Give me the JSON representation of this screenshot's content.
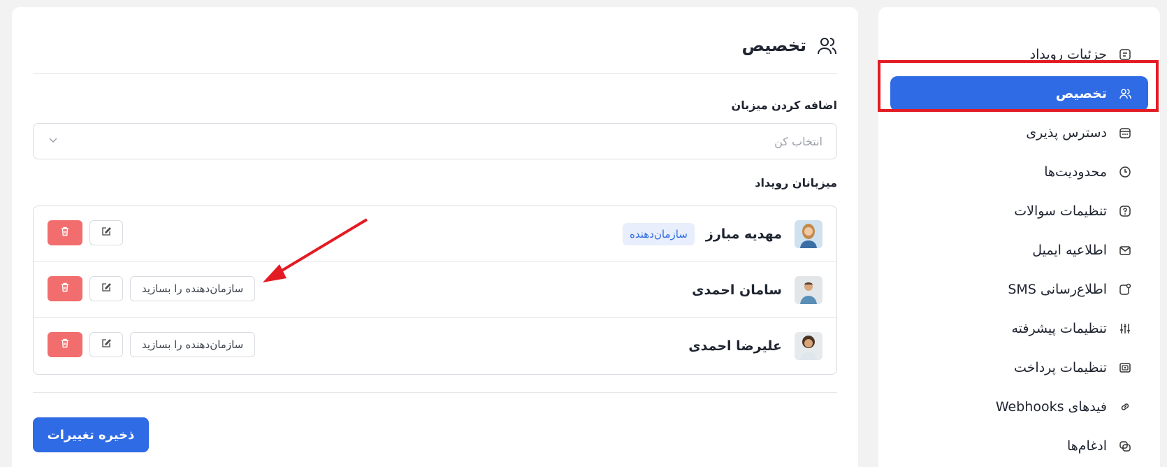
{
  "sidebar": {
    "items": [
      {
        "label": "جزئیات رویداد",
        "icon": "calendar-note-icon"
      },
      {
        "label": "تخصیص",
        "icon": "users-icon",
        "active": true
      },
      {
        "label": "دسترس پذیری",
        "icon": "calendar-icon"
      },
      {
        "label": "محدودیت‌ها",
        "icon": "clock-icon"
      },
      {
        "label": "تنظیمات سوالات",
        "icon": "question-icon"
      },
      {
        "label": "اطلاعیه ایمیل",
        "icon": "mail-icon"
      },
      {
        "label": "اطلاع‌رسانی SMS",
        "icon": "sms-icon"
      },
      {
        "label": "تنظیمات پیشرفته",
        "icon": "sliders-icon"
      },
      {
        "label": "تنظیمات پرداخت",
        "icon": "payment-icon"
      },
      {
        "label": "فیدهای Webhooks",
        "icon": "link-icon"
      },
      {
        "label": "ادغام‌ها",
        "icon": "integration-icon"
      }
    ]
  },
  "main": {
    "title": "تخصیص",
    "add_host_label": "اضافه کردن میزبان",
    "select_placeholder": "انتخاب کن",
    "hosts_label": "میزبانان رویداد",
    "hosts": [
      {
        "name": "مهدیه مبارز",
        "badge": "سازمان‌دهنده",
        "make_label": ""
      },
      {
        "name": "سامان احمدی",
        "badge": "",
        "make_label": "سازمان‌دهنده را بسازید"
      },
      {
        "name": "علیرضا احمدی",
        "badge": "",
        "make_label": "سازمان‌دهنده را بسازید"
      }
    ],
    "save_label": "ذخیره تغییرات"
  },
  "colors": {
    "accent": "#2f6be4",
    "danger": "#f26d6d",
    "highlight": "#e31b23"
  }
}
